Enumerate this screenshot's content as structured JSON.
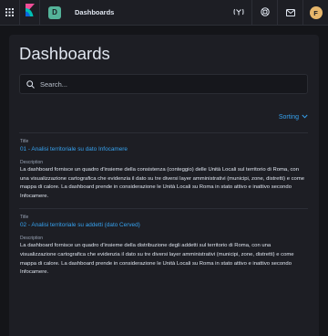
{
  "header": {
    "space_initial": "D",
    "breadcrumb": "Dashboards",
    "user_initial": "F",
    "accent_color": "#36a2ef",
    "space_color": "#54b399",
    "avatar_color": "#e7b66b"
  },
  "icons": {
    "menu": "app-menu-icon",
    "logo": "kibana-logo",
    "newsfeed": "newsfeed-icon",
    "help": "help-icon",
    "mail": "mail-icon"
  },
  "page": {
    "title": "Dashboards",
    "search_placeholder": "Search...",
    "sort_label": "Sorting"
  },
  "list": {
    "items": [
      {
        "title_label": "Title",
        "title": "01 - Analisi territoriale su dato Infocamere",
        "description_label": "Description",
        "description": "La dashboard fornisce un quadro d'insieme della consistenza (conteggio) delle Unità Locali sul territorio di Roma, con una visualizzazione cartografica che evidenzia il dato su tre diversi layer amministrativi (municipi, zone, distretti) e come mappa di calore. La dashboard prende in considerazione le Unità Locali su Roma in stato attivo e inattivo secondo Infocamere."
      },
      {
        "title_label": "Title",
        "title": "02 - Analisi territoriale su addetti (dato Cerved)",
        "description_label": "Description",
        "description": "La dashboard fornisce un quadro d'insieme della distribuzione degli addetti sul territorio di Roma, con una visualizzazione cartografica che evidenzia il dato su tre diversi layer amministrativi (municipi, zone, distretti) e come mappa di calore. La dashboard prende in considerazione le Unità Locali su Roma in stato attivo e inattivo secondo Infocamere."
      }
    ]
  }
}
